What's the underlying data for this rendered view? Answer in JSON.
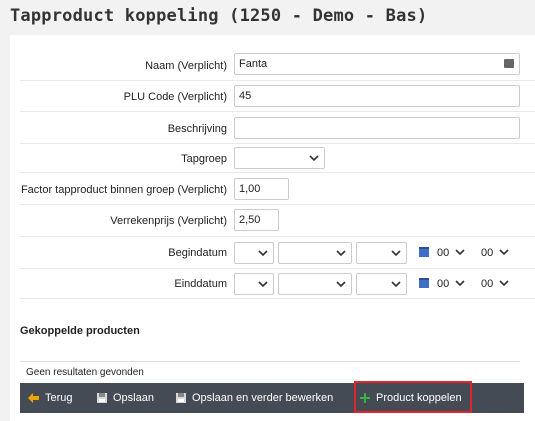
{
  "page_title": "Tapproduct koppeling (1250 - Demo - Bas)",
  "form": {
    "naam": {
      "label": "Naam (Verplicht)",
      "value": "Fanta"
    },
    "plu": {
      "label": "PLU Code (Verplicht)",
      "value": "45"
    },
    "beschrijving": {
      "label": "Beschrijving",
      "value": ""
    },
    "tapgroep": {
      "label": "Tapgroep",
      "value": ""
    },
    "factor": {
      "label": "Factor tapproduct binnen groep (Verplicht)",
      "value": "1,00"
    },
    "verrekenprijs": {
      "label": "Verrekenprijs (Verplicht)",
      "value": "2,50"
    },
    "begindatum": {
      "label": "Begindatum",
      "hour": "00",
      "minute": "00"
    },
    "einddatum": {
      "label": "Einddatum",
      "hour": "00",
      "minute": "00"
    }
  },
  "linked": {
    "title": "Gekoppelde producten",
    "empty_text": "Geen resultaten gevonden"
  },
  "toolbar": {
    "back": "Terug",
    "save": "Opslaan",
    "save_continue": "Opslaan en verder bewerken",
    "link_product": "Product koppelen"
  },
  "colors": {
    "toolbar_bg": "#444b54",
    "highlight": "#e0262b",
    "back_arrow": "#f0a500",
    "plus": "#3cb043"
  }
}
